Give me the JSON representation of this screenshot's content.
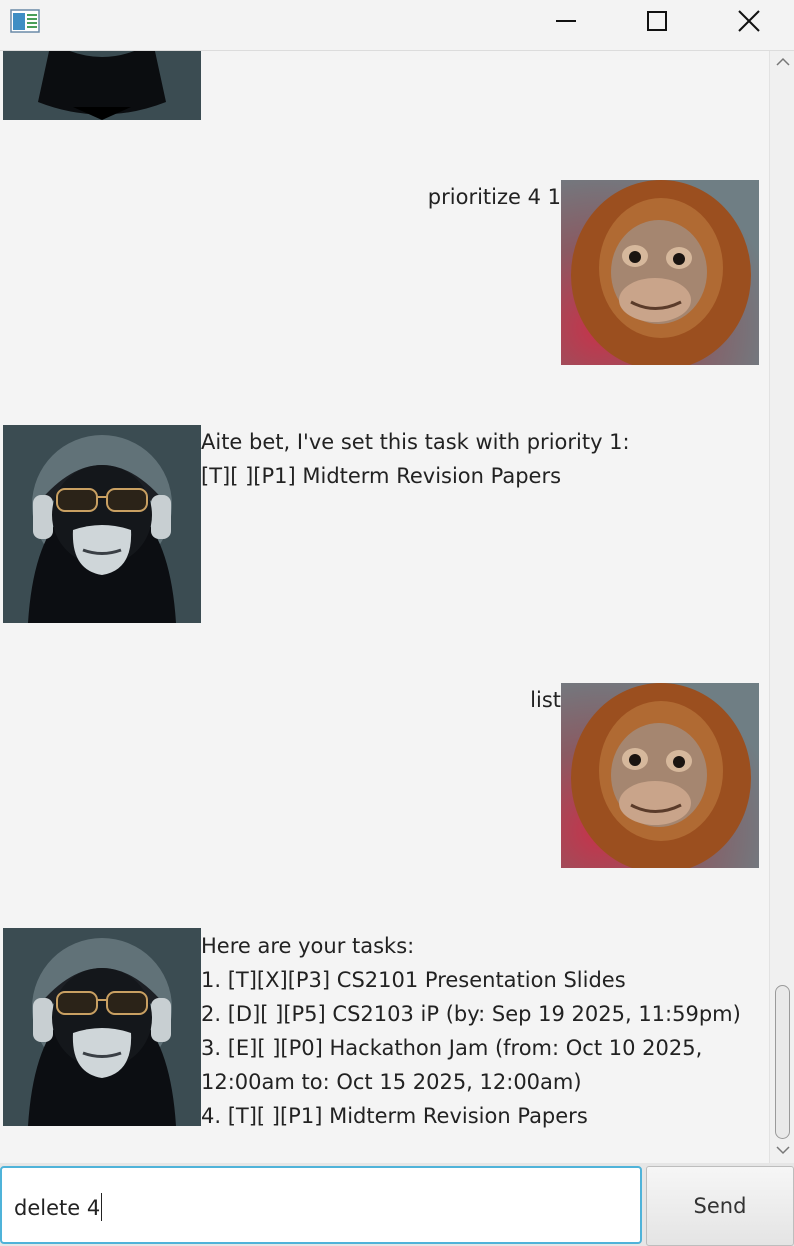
{
  "input": {
    "value": "delete 4"
  },
  "send_label": "Send",
  "messages": [
    {
      "sender": "user",
      "avatar": "orangutan-avatar",
      "lines": [
        "prioritize 4 1"
      ]
    },
    {
      "sender": "bot",
      "avatar": "gorilla-avatar",
      "lines": [
        "Aite bet, I've set this task with priority 1:",
        "[T][ ][P1] Midterm Revision Papers"
      ]
    },
    {
      "sender": "user",
      "avatar": "orangutan-avatar",
      "lines": [
        "list"
      ]
    },
    {
      "sender": "bot",
      "avatar": "gorilla-avatar",
      "lines": [
        "Here are your tasks:",
        "1. [T][X][P3] CS2101 Presentation Slides",
        "2. [D][ ][P5] CS2103 iP (by: Sep 19 2025, 11:59pm)",
        "3. [E][ ][P0] Hackathon Jam (from: Oct 10 2025,",
        "12:00am to: Oct 15 2025, 12:00am)",
        "4. [T][ ][P1] Midterm Revision Papers"
      ]
    }
  ],
  "icons": {
    "app": "app-window-icon",
    "minimize": "minimize-icon",
    "maximize": "maximize-icon",
    "close": "close-icon",
    "scroll_up": "chevron-up-icon",
    "scroll_down": "chevron-down-icon"
  },
  "colors": {
    "input_focus": "#4fb3d9",
    "background": "#f4f4f4"
  }
}
